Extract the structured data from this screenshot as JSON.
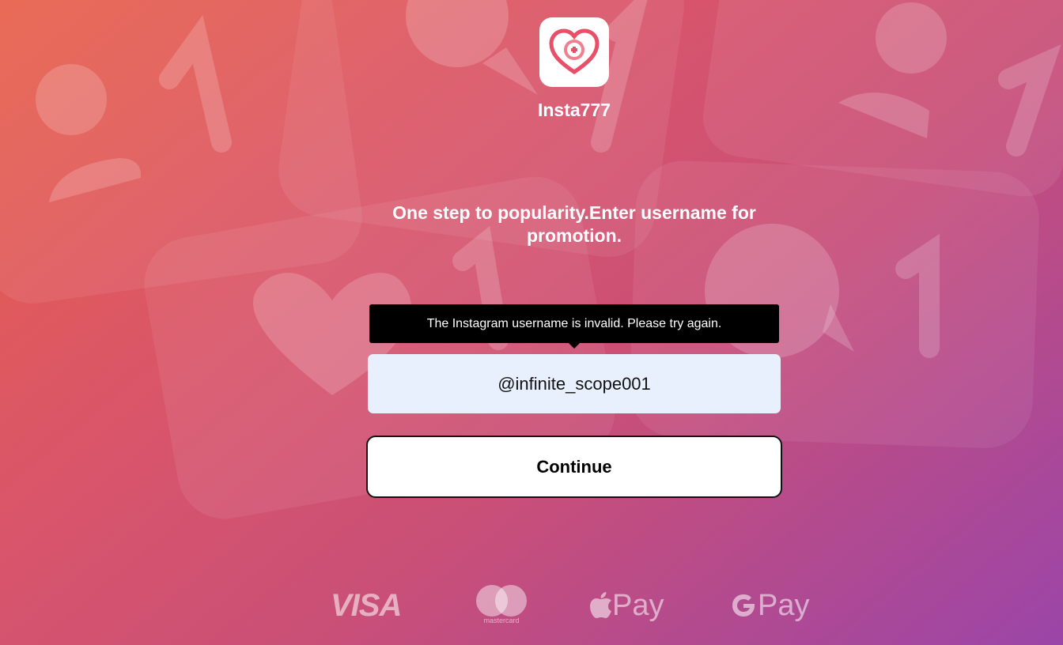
{
  "app": {
    "name": "Insta777"
  },
  "headline": "One step to popularity.Enter username for promotion.",
  "error_tooltip": "The Instagram username is invalid. Please try again.",
  "username_input": {
    "value": "@infinite_scope001"
  },
  "continue_label": "Continue",
  "payments": {
    "visa": "VISA",
    "mastercard": "mastercard",
    "apple_pay": "Pay",
    "google_pay": "Pay"
  },
  "colors": {
    "gradient_start": "#e8604a",
    "gradient_mid": "#c94f78",
    "gradient_end": "#9b45a8",
    "logo_heart": "#e8506a",
    "input_bg": "#e8f0fe"
  },
  "icons": [
    "heart-plus-logo-icon",
    "apple-icon",
    "google-g-icon",
    "mastercard-circles-icon"
  ]
}
